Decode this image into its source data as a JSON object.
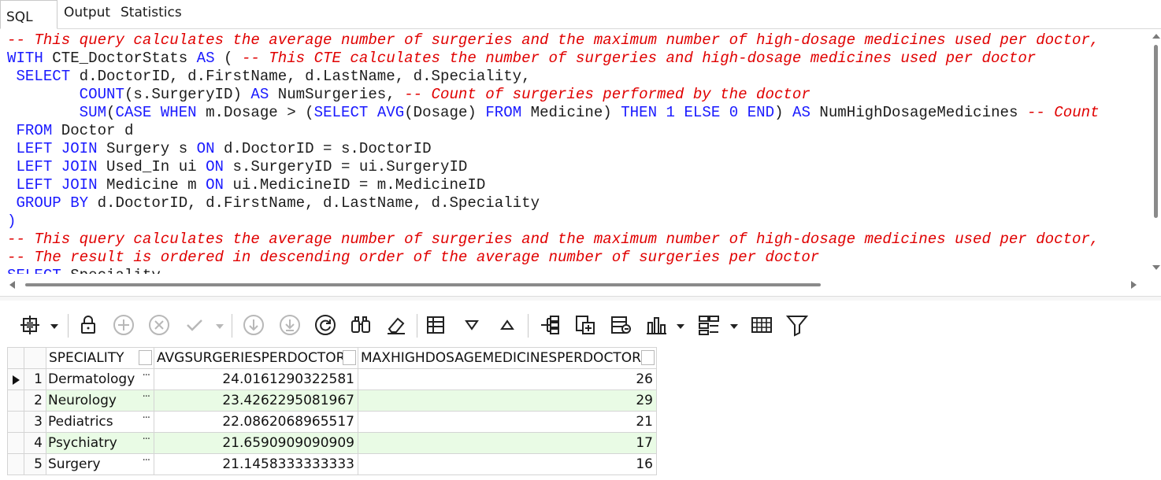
{
  "tabs": [
    {
      "label": "SQL"
    },
    {
      "label": "Output"
    },
    {
      "label": "Statistics"
    }
  ],
  "editor": {
    "lines": [
      [
        {
          "t": "-- This query calculates the average number of surgeries and the maximum number of high-dosage medicines used per doctor,",
          "c": "cm"
        }
      ],
      [
        {
          "t": "WITH",
          "c": "kw"
        },
        {
          "t": " CTE_DoctorStats ",
          "c": ""
        },
        {
          "t": "AS",
          "c": "kw"
        },
        {
          "t": " ( ",
          "c": ""
        },
        {
          "t": "-- This CTE calculates the number of surgeries and high-dosage medicines used per doctor",
          "c": "cm"
        }
      ],
      [
        {
          "t": " ",
          "c": ""
        },
        {
          "t": "SELECT",
          "c": "kw"
        },
        {
          "t": " d.DoctorID, d.FirstName, d.LastName, d.Speciality,",
          "c": ""
        }
      ],
      [
        {
          "t": "        ",
          "c": ""
        },
        {
          "t": "COUNT",
          "c": "kw"
        },
        {
          "t": "(s.SurgeryID) ",
          "c": ""
        },
        {
          "t": "AS",
          "c": "kw"
        },
        {
          "t": " NumSurgeries, ",
          "c": ""
        },
        {
          "t": "-- Count of surgeries performed by the doctor",
          "c": "cm"
        }
      ],
      [
        {
          "t": "        ",
          "c": ""
        },
        {
          "t": "SUM",
          "c": "kw"
        },
        {
          "t": "(",
          "c": ""
        },
        {
          "t": "CASE WHEN",
          "c": "kw"
        },
        {
          "t": " m.Dosage > (",
          "c": ""
        },
        {
          "t": "SELECT AVG",
          "c": "kw"
        },
        {
          "t": "(Dosage) ",
          "c": ""
        },
        {
          "t": "FROM",
          "c": "kw"
        },
        {
          "t": " Medicine) ",
          "c": ""
        },
        {
          "t": "THEN",
          "c": "kw"
        },
        {
          "t": " ",
          "c": ""
        },
        {
          "t": "1",
          "c": "num"
        },
        {
          "t": " ",
          "c": ""
        },
        {
          "t": "ELSE",
          "c": "kw"
        },
        {
          "t": " ",
          "c": ""
        },
        {
          "t": "0",
          "c": "num"
        },
        {
          "t": " ",
          "c": ""
        },
        {
          "t": "END",
          "c": "kw"
        },
        {
          "t": ") ",
          "c": ""
        },
        {
          "t": "AS",
          "c": "kw"
        },
        {
          "t": " NumHighDosageMedicines ",
          "c": ""
        },
        {
          "t": "-- Count",
          "c": "cm"
        }
      ],
      [
        {
          "t": " ",
          "c": ""
        },
        {
          "t": "FROM",
          "c": "kw"
        },
        {
          "t": " Doctor d",
          "c": ""
        }
      ],
      [
        {
          "t": " ",
          "c": ""
        },
        {
          "t": "LEFT JOIN",
          "c": "kw"
        },
        {
          "t": " Surgery s ",
          "c": ""
        },
        {
          "t": "ON",
          "c": "kw"
        },
        {
          "t": " d.DoctorID = s.DoctorID",
          "c": ""
        }
      ],
      [
        {
          "t": " ",
          "c": ""
        },
        {
          "t": "LEFT JOIN",
          "c": "kw"
        },
        {
          "t": " Used_In ui ",
          "c": ""
        },
        {
          "t": "ON",
          "c": "kw"
        },
        {
          "t": " s.SurgeryID = ui.SurgeryID",
          "c": ""
        }
      ],
      [
        {
          "t": " ",
          "c": ""
        },
        {
          "t": "LEFT JOIN",
          "c": "kw"
        },
        {
          "t": " Medicine m ",
          "c": ""
        },
        {
          "t": "ON",
          "c": "kw"
        },
        {
          "t": " ui.MedicineID = m.MedicineID",
          "c": ""
        }
      ],
      [
        {
          "t": " ",
          "c": ""
        },
        {
          "t": "GROUP BY",
          "c": "kw"
        },
        {
          "t": " d.DoctorID, d.FirstName, d.LastName, d.Speciality",
          "c": ""
        }
      ],
      [
        {
          "t": ")",
          "c": "kw"
        }
      ],
      [
        {
          "t": "-- This query calculates the average number of surgeries and the maximum number of high-dosage medicines used per doctor,",
          "c": "cm"
        }
      ],
      [
        {
          "t": "-- The result is ordered in descending order of the average number of surgeries per doctor",
          "c": "cm"
        }
      ],
      [
        {
          "t": "SELECT",
          "c": "kw"
        },
        {
          "t": " Speciality,",
          "c": ""
        }
      ]
    ]
  },
  "toolbar": {
    "icons": [
      "record-navigator-icon",
      "lock-icon",
      "add-row-icon",
      "delete-row-icon",
      "apply-icon",
      "next-icon",
      "last-icon",
      "refresh-icon",
      "find-icon",
      "clear-icon",
      "grid-view-icon",
      "sort-desc-icon",
      "sort-asc-icon",
      "tree-icon",
      "export-icon",
      "import-icon",
      "chart-icon",
      "group-icon",
      "table-icon",
      "filter-icon"
    ]
  },
  "grid": {
    "columns": [
      "SPECIALITY",
      "AVGSURGERIESPERDOCTOR",
      "MAXHIGHDOSAGEMEDICINESPERDOCTOR"
    ],
    "rows": [
      {
        "n": "1",
        "speciality": "Dermatology",
        "avg": "24.0161290322581",
        "max": "26"
      },
      {
        "n": "2",
        "speciality": "Neurology",
        "avg": "23.4262295081967",
        "max": "29"
      },
      {
        "n": "3",
        "speciality": "Pediatrics",
        "avg": "22.0862068965517",
        "max": "21"
      },
      {
        "n": "4",
        "speciality": "Psychiatry",
        "avg": "21.6590909090909",
        "max": "17"
      },
      {
        "n": "5",
        "speciality": "Surgery",
        "avg": "21.1458333333333",
        "max": "16"
      }
    ],
    "ellipsis": "···",
    "alt_row_color": "#e9fbe5"
  }
}
